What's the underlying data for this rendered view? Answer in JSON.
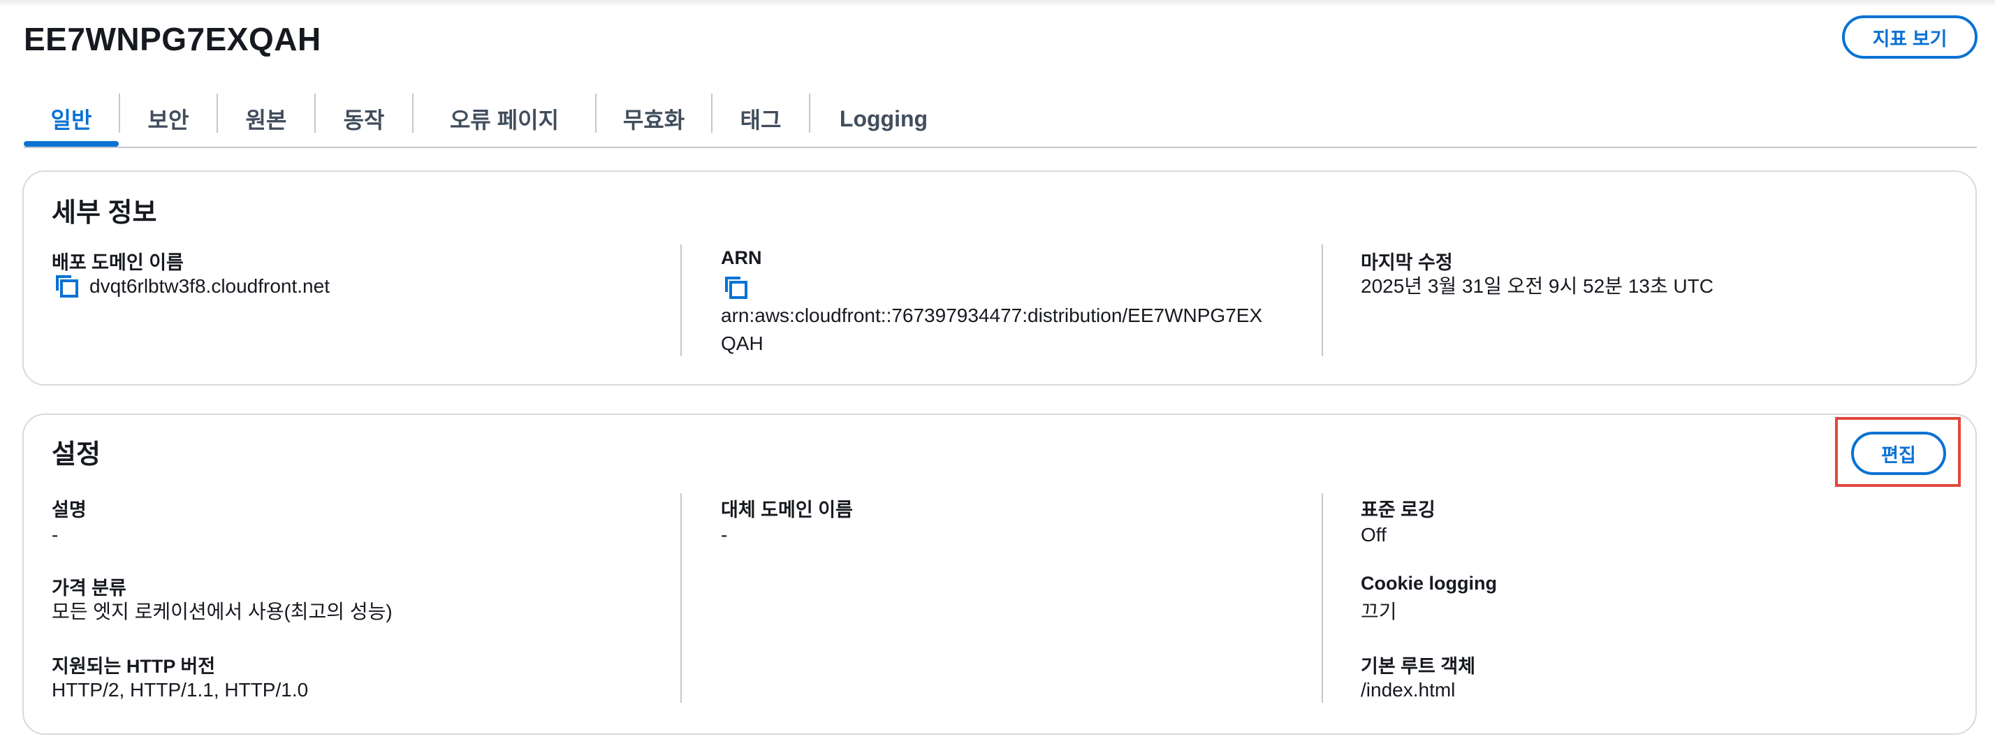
{
  "header": {
    "title": "EE7WNPG7EXQAH",
    "metrics_button": "지표 보기"
  },
  "tabs": [
    {
      "label": "일반",
      "active": true
    },
    {
      "label": "보안"
    },
    {
      "label": "원본"
    },
    {
      "label": "동작"
    },
    {
      "label": "오류 페이지"
    },
    {
      "label": "무효화"
    },
    {
      "label": "태그"
    },
    {
      "label": "Logging"
    }
  ],
  "details": {
    "title": "세부 정보",
    "domain_label": "배포 도메인 이름",
    "domain_value": "dvqt6rlbtw3f8.cloudfront.net",
    "arn_label": "ARN",
    "arn_value_line1": "arn:aws:cloudfront::767397934477:distribution/EE7WNPG7EX",
    "arn_value_line2": "QAH",
    "modified_label": "마지막 수정",
    "modified_value": "2025년 3월 31일 오전 9시 52분 13초 UTC"
  },
  "settings": {
    "title": "설정",
    "edit_button": "편집",
    "description_label": "설명",
    "description_value": "-",
    "price_class_label": "가격 분류",
    "price_class_value": "모든 엣지 로케이션에서 사용(최고의 성능)",
    "http_versions_label": "지원되는 HTTP 버전",
    "http_versions_value": "HTTP/2, HTTP/1.1, HTTP/1.0",
    "alt_domain_label": "대체 도메인 이름",
    "alt_domain_value": "-",
    "standard_logging_label": "표준 로깅",
    "standard_logging_value": "Off",
    "cookie_logging_label": "Cookie logging",
    "cookie_logging_value": "끄기",
    "default_root_label": "기본 루트 객체",
    "default_root_value": "/index.html"
  },
  "colors": {
    "accent": "#0972d3",
    "highlight": "#e0483c",
    "text": "#16191f",
    "border": "#d5dbdb"
  },
  "icons": {
    "copy": "copy-icon"
  }
}
